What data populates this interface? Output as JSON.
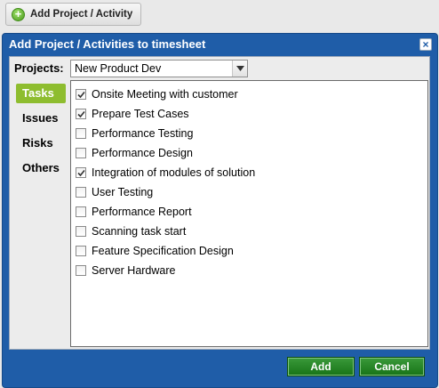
{
  "toolbar": {
    "add_button_label": "Add Project / Activity"
  },
  "dialog": {
    "title": "Add Project / Activities to timesheet",
    "close_label": "×",
    "projects_label": "Projects:",
    "project_selected": "New Product Dev",
    "tabs": [
      {
        "label": "Tasks",
        "active": true
      },
      {
        "label": "Issues",
        "active": false
      },
      {
        "label": "Risks",
        "active": false
      },
      {
        "label": "Others",
        "active": false
      }
    ],
    "tasks": [
      {
        "label": "Onsite Meeting with customer",
        "checked": true
      },
      {
        "label": "Prepare Test Cases",
        "checked": true
      },
      {
        "label": "Performance Testing",
        "checked": false
      },
      {
        "label": "Performance Design",
        "checked": false
      },
      {
        "label": "Integration of modules of solution",
        "checked": true
      },
      {
        "label": "User Testing",
        "checked": false
      },
      {
        "label": "Performance Report",
        "checked": false
      },
      {
        "label": "Scanning task start",
        "checked": false
      },
      {
        "label": "Feature Specification Design",
        "checked": false
      },
      {
        "label": "Server Hardware",
        "checked": false
      }
    ],
    "add_label": "Add",
    "cancel_label": "Cancel"
  },
  "colors": {
    "dialog_blue": "#1f5da8",
    "tab_active_green": "#8ebd2f",
    "button_green": "#177317"
  },
  "icons": {
    "toolbar": "plus-circle-icon",
    "close": "close-icon",
    "select": "chevron-down-icon",
    "checkbox": "checkmark-icon"
  }
}
